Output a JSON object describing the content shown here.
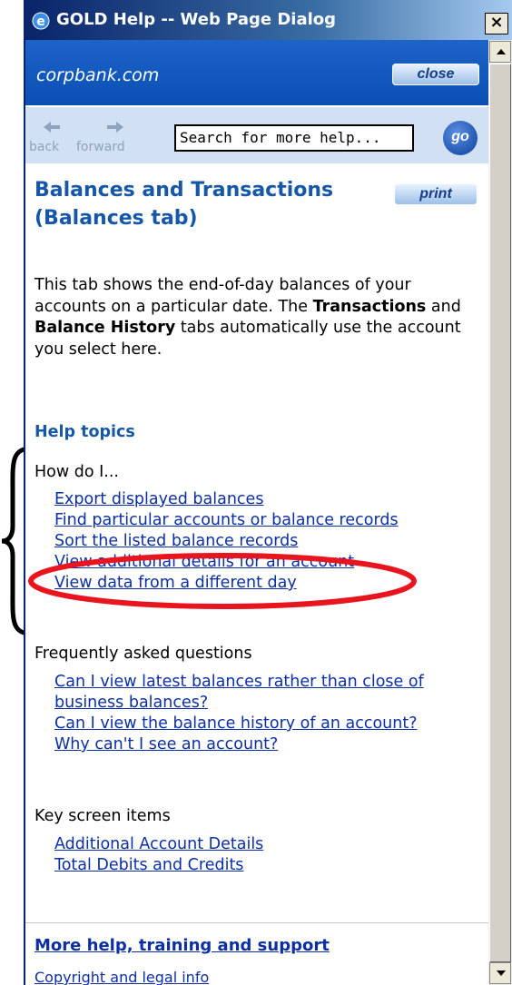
{
  "window": {
    "title": "GOLD Help -- Web Page Dialog",
    "close_glyph": "×"
  },
  "header": {
    "site": "corpbank.com",
    "close_label": "close"
  },
  "nav": {
    "back_label": "back",
    "forward_label": "forward",
    "search_value": "Search for more help...",
    "go_label": "go"
  },
  "page": {
    "title": "Balances and Transactions (Balances tab)",
    "print_label": "print",
    "intro": {
      "part1": "This tab shows the end-of-day balances of your accounts on a particular date. The ",
      "bold1": "Transactions",
      "part2": " and ",
      "bold2": "Balance History",
      "part3": " tabs automatically use the account you select here."
    },
    "topics_heading": "Help topics",
    "sections": {
      "howdoi": {
        "label": "How do I...",
        "links": [
          "Export displayed balances",
          "Find particular accounts or balance records",
          "Sort the listed balance records",
          "View additional details for an account",
          "View data from a different day"
        ]
      },
      "faq": {
        "label": "Frequently asked questions",
        "links": [
          "Can I view latest balances rather than close of business balances?",
          "Can I view the balance history of an account?",
          "Why can't I see an account?"
        ]
      },
      "keyitems": {
        "label": "Key screen items",
        "links": [
          "Additional Account Details",
          "Total Debits and Credits"
        ]
      }
    },
    "more_help": "More help, training and support",
    "copyright": "Copyright and legal info"
  },
  "colors": {
    "header_blue": "#0a50b4",
    "title_blue": "#1757a8",
    "link_blue": "#0c2fa6",
    "annotation_red": "#e8141e"
  }
}
